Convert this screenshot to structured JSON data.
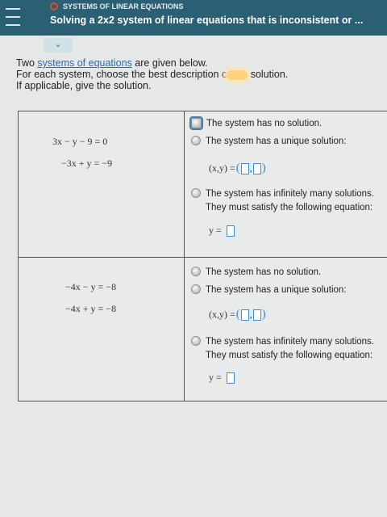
{
  "header": {
    "topic": "SYSTEMS OF LINEAR EQUATIONS",
    "title": "Solving a 2x2 system of linear equations that is inconsistent or ..."
  },
  "instructions": {
    "line1_pre": "Two ",
    "line1_link": "systems of equations",
    "line1_post": " are given below.",
    "line2_pre": "For each system, choose the best description c",
    "line2_post": " solution.",
    "line3": "If applicable, give the solution."
  },
  "systems": [
    {
      "eq1": "3x − y − 9  =  0",
      "eq2": "−3x + y  =  −9",
      "option_no_solution": "The system has no solution.",
      "option_unique": "The system has a unique solution:",
      "unique_label": "(x,y)  =",
      "option_infinite_line1": "The system has infinitely many solutions.",
      "option_infinite_line2": "They must satisfy the following equation:",
      "infinite_label": "y  ="
    },
    {
      "eq1": "−4x − y  =  −8",
      "eq2": "−4x + y  =  −8",
      "option_no_solution": "The system has no solution.",
      "option_unique": "The system has a unique solution:",
      "unique_label": "(x,y)  =",
      "option_infinite_line1": "The system has infinitely many solutions.",
      "option_infinite_line2": "They must satisfy the following equation:",
      "infinite_label": "y  ="
    }
  ],
  "collapse_icon": "chevron-down-icon",
  "menu_icon": "hamburger-icon"
}
